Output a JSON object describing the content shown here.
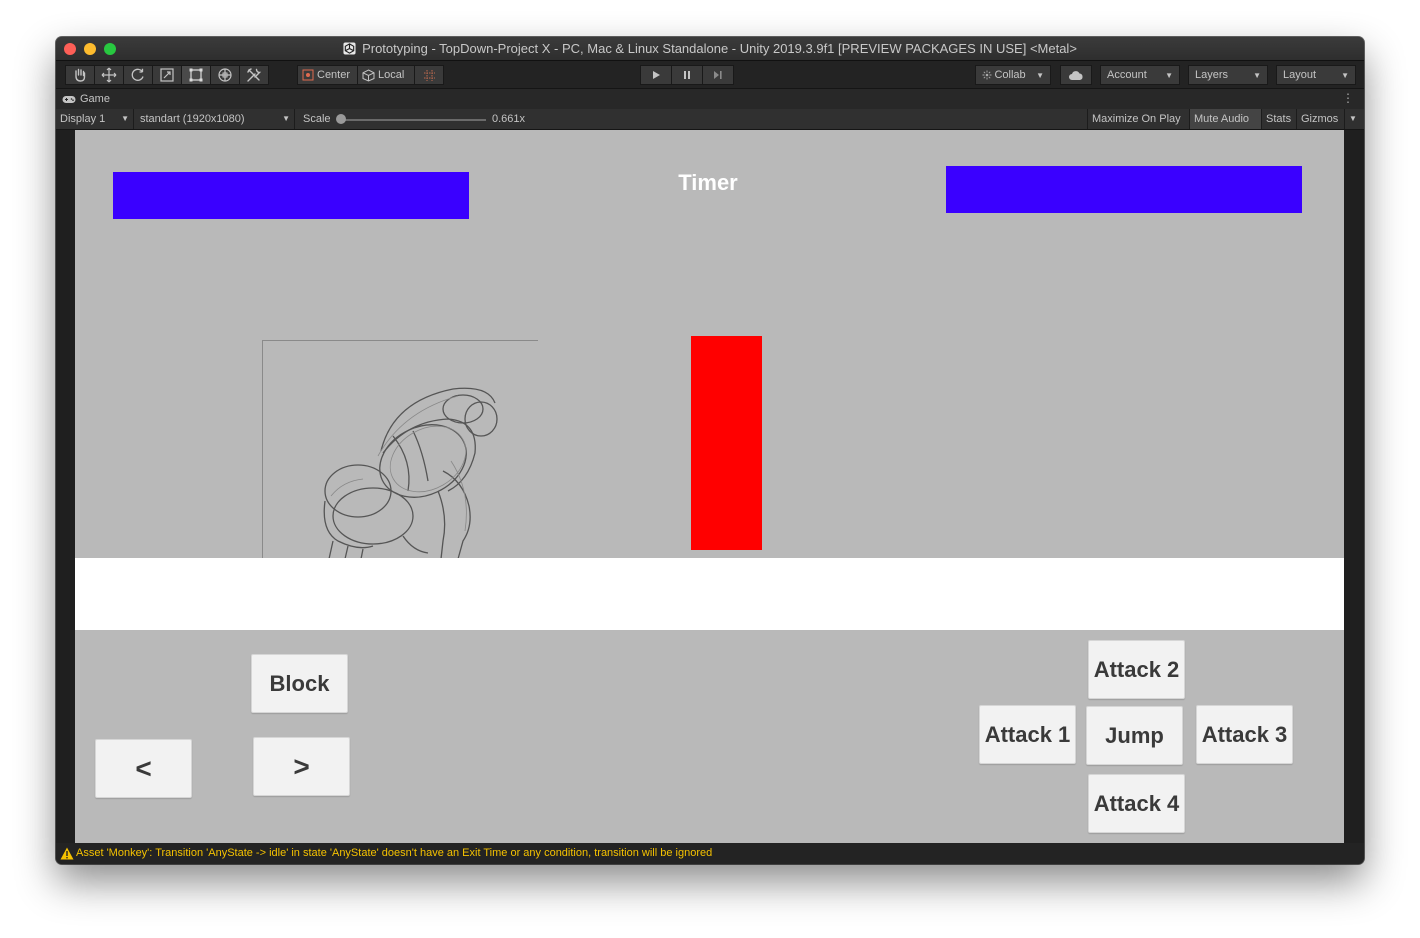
{
  "window": {
    "title": "Prototyping - TopDown-Project X - PC, Mac & Linux Standalone - Unity 2019.3.9f1 [PREVIEW PACKAGES IN USE] <Metal>"
  },
  "toolbar": {
    "pivot_label": "Center",
    "space_label": "Local",
    "collab_label": "Collab",
    "account_label": "Account",
    "layers_label": "Layers",
    "layout_label": "Layout"
  },
  "game_tab": {
    "label": "Game"
  },
  "game_controls": {
    "display": "Display 1",
    "resolution": "standart (1920x1080)",
    "scale_label": "Scale",
    "scale_value": "0.661x",
    "maximize_on_play": "Maximize On Play",
    "mute_audio": "Mute Audio",
    "stats": "Stats",
    "gizmos": "Gizmos"
  },
  "game": {
    "timer_label": "Timer",
    "colors": {
      "health_bar": "#3a00ff",
      "enemy_block": "#ff0000",
      "ground": "#ffffff",
      "background": "#b9b9b9"
    },
    "buttons": {
      "block": "Block",
      "left": "<",
      "right": ">",
      "attack1": "Attack 1",
      "attack2": "Attack 2",
      "attack3": "Attack 3",
      "attack4": "Attack 4",
      "jump": "Jump"
    }
  },
  "status": {
    "message": "Asset 'Monkey': Transition 'AnyState -> idle' in state 'AnyState' doesn't have an Exit Time or any condition, transition will be ignored"
  }
}
